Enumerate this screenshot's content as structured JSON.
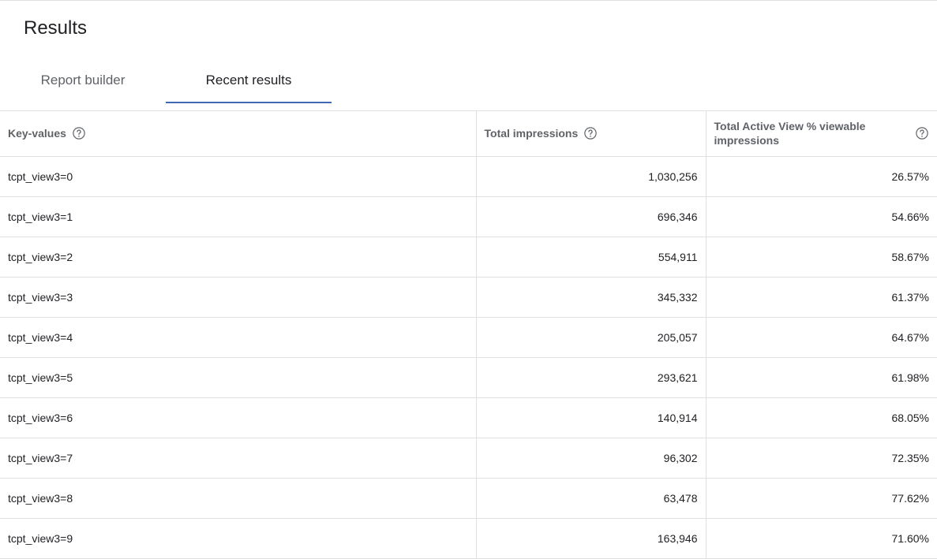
{
  "page": {
    "title": "Results"
  },
  "tabs": [
    {
      "label": "Report builder",
      "active": false
    },
    {
      "label": "Recent results",
      "active": true
    }
  ],
  "colors": {
    "accent": "#3c6ab6",
    "divider": "#e0e0e0",
    "header_text": "#5f6368",
    "body_text": "#202124"
  },
  "table": {
    "headers": [
      {
        "label": "Key-values",
        "icon": "help-circle-icon"
      },
      {
        "label": "Total impressions",
        "icon": "help-circle-icon"
      },
      {
        "label": "Total Active View % viewable impressions",
        "icon": "help-circle-icon"
      }
    ],
    "rows": [
      [
        "tcpt_view3=0",
        "1,030,256",
        "26.57%"
      ],
      [
        "tcpt_view3=1",
        "696,346",
        "54.66%"
      ],
      [
        "tcpt_view3=2",
        "554,911",
        "58.67%"
      ],
      [
        "tcpt_view3=3",
        "345,332",
        "61.37%"
      ],
      [
        "tcpt_view3=4",
        "205,057",
        "64.67%"
      ],
      [
        "tcpt_view3=5",
        "293,621",
        "61.98%"
      ],
      [
        "tcpt_view3=6",
        "140,914",
        "68.05%"
      ],
      [
        "tcpt_view3=7",
        "96,302",
        "72.35%"
      ],
      [
        "tcpt_view3=8",
        "63,478",
        "77.62%"
      ],
      [
        "tcpt_view3=9",
        "163,946",
        "71.60%"
      ]
    ]
  }
}
